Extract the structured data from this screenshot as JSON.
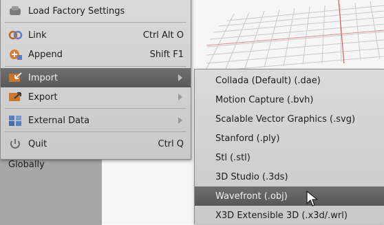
{
  "background": {
    "viewport_color": "#f6f6f6",
    "grid_color": "#c8c8c8",
    "axis_color": "#d95a5a",
    "panel_color": "#a7a7a7"
  },
  "side_panel": {
    "text": "Globally"
  },
  "file_menu": {
    "items": [
      {
        "label": "Load Factory Settings",
        "icon": "factory-settings-icon",
        "shortcut": "",
        "highlighted": false,
        "submenu": false
      },
      {
        "label": "Link",
        "icon": "link-icon",
        "shortcut": "Ctrl Alt O",
        "highlighted": false,
        "submenu": false
      },
      {
        "label": "Append",
        "icon": "append-icon",
        "shortcut": "Shift F1",
        "highlighted": false,
        "submenu": false
      },
      {
        "label": "Import",
        "icon": "import-icon",
        "shortcut": "",
        "highlighted": true,
        "submenu": true
      },
      {
        "label": "Export",
        "icon": "export-icon",
        "shortcut": "",
        "highlighted": false,
        "submenu": true
      },
      {
        "label": "External Data",
        "icon": "external-data-icon",
        "shortcut": "",
        "highlighted": false,
        "submenu": true
      },
      {
        "label": "Quit",
        "icon": "power-icon",
        "shortcut": "Ctrl Q",
        "highlighted": false,
        "submenu": false
      }
    ]
  },
  "import_menu": {
    "items": [
      {
        "label": "Collada (Default) (.dae)",
        "highlighted": false
      },
      {
        "label": "Motion Capture (.bvh)",
        "highlighted": false
      },
      {
        "label": "Scalable Vector Graphics (.svg)",
        "highlighted": false
      },
      {
        "label": "Stanford (.ply)",
        "highlighted": false
      },
      {
        "label": "Stl (.stl)",
        "highlighted": false
      },
      {
        "label": "3D Studio (.3ds)",
        "highlighted": false
      },
      {
        "label": "Wavefront (.obj)",
        "highlighted": true
      },
      {
        "label": "X3D Extensible 3D (.x3d/.wrl)",
        "highlighted": false
      }
    ]
  },
  "colors": {
    "menu_bg": "#d2d2d2",
    "highlight_bg": "#636363",
    "highlight_text": "#eeeeee"
  }
}
